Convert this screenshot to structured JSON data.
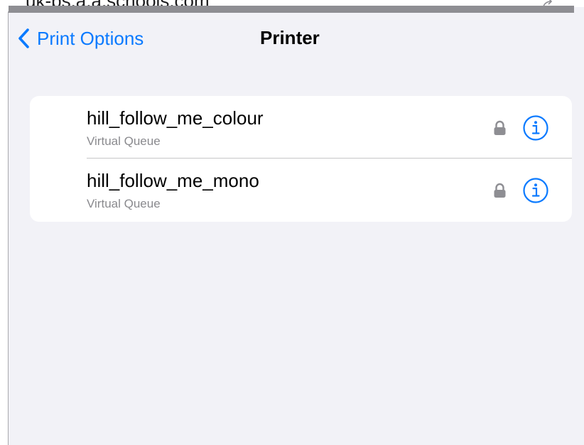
{
  "background": {
    "url_fragment": "uk-ps.a.a.schools.com"
  },
  "nav": {
    "back_label": "Print Options",
    "title": "Printer"
  },
  "printers": [
    {
      "name": "hill_follow_me_colour",
      "subtitle": "Virtual Queue"
    },
    {
      "name": "hill_follow_me_mono",
      "subtitle": "Virtual Queue"
    }
  ],
  "colors": {
    "accent": "#0a7aff",
    "background": "#f2f2f7",
    "card": "#ffffff",
    "secondary_text": "#8a8a8e",
    "lock": "#8e8e93"
  }
}
